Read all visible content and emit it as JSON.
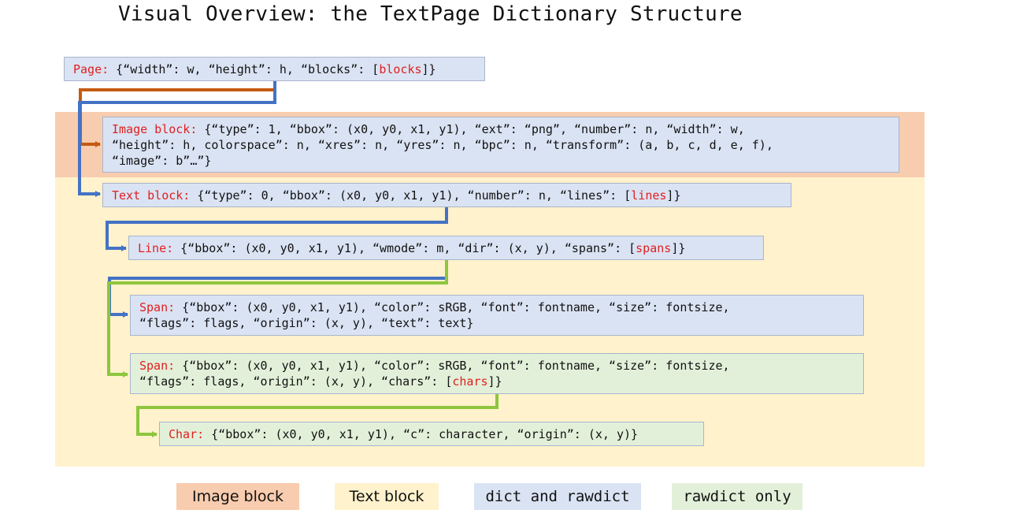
{
  "title": "Visual Overview: the TextPage Dictionary Structure",
  "colors": {
    "image_block": "#f8ccae",
    "text_block": "#fff2cc",
    "dict_and_rawdict": "#dae3f3",
    "rawdict_only": "#e2f0d9",
    "key_label": "#e02020",
    "arrow_orange": "#c55a11",
    "arrow_blue": "#4472c4",
    "arrow_green": "#8dc63f"
  },
  "page": {
    "label": "Page:",
    "body": " {“width”: w, “height”: h, “blocks”: [",
    "ref": "blocks",
    "end": "]}"
  },
  "image_block": {
    "label": "Image block:",
    "line1": " {“type”: 1, “bbox”: (x0, y0, x1, y1), “ext”: “png”, “number”: n, “width”: w,",
    "line2": "“height”: h, colorspace”: n, “xres”: n, “yres”: n, “bpc”: n, “transform”: (a, b, c, d, e, f),",
    "line3": "“image”: b”…”}"
  },
  "text_block": {
    "label": "Text block:",
    "body": " {“type”: 0, “bbox”: (x0, y0, x1, y1), “number”: n, “lines”: [",
    "ref": "lines",
    "end": "]}"
  },
  "line": {
    "label": "Line:",
    "body": " {“bbox”: (x0, y0, x1, y1), “wmode”: m, “dir”: (x, y), “spans”: [",
    "ref": "spans",
    "end": "]}"
  },
  "span_dict": {
    "label": "Span:",
    "line1": " {“bbox”: (x0, y0, x1, y1), “color”: sRGB, “font”: fontname, “size”: fontsize,",
    "line2": "“flags”: flags, “origin”: (x, y), “text”: text}"
  },
  "span_raw": {
    "label": "Span:",
    "line1": " {“bbox”: (x0, y0, x1, y1), “color”: sRGB, “font”: fontname, “size”: fontsize,",
    "line2": "“flags”: flags, “origin”: (x, y), “chars”: [",
    "ref": "chars",
    "end": "]}"
  },
  "char": {
    "label": "Char:",
    "body": " {“bbox”: (x0, y0, x1, y1), “c”: character, “origin”: (x, y)}"
  },
  "legend": {
    "image_block": "Image block",
    "text_block": "Text block",
    "dict_and_rawdict": "dict and rawdict",
    "rawdict_only": "rawdict only"
  }
}
